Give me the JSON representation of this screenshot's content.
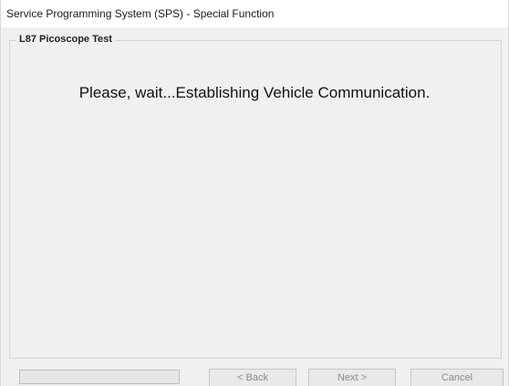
{
  "window": {
    "title": "Service Programming System (SPS) - Special Function"
  },
  "group": {
    "title": "L87 Picoscope Test"
  },
  "message": "Please, wait...Establishing Vehicle Communication.",
  "progress": {
    "value": 0
  },
  "buttons": {
    "back": "< Back",
    "next": "Next >",
    "cancel": "Cancel"
  },
  "colors": {
    "window_bg": "#f0f0f0",
    "titlebar_bg": "#ffffff",
    "disabled_text": "#8a8a8a"
  }
}
